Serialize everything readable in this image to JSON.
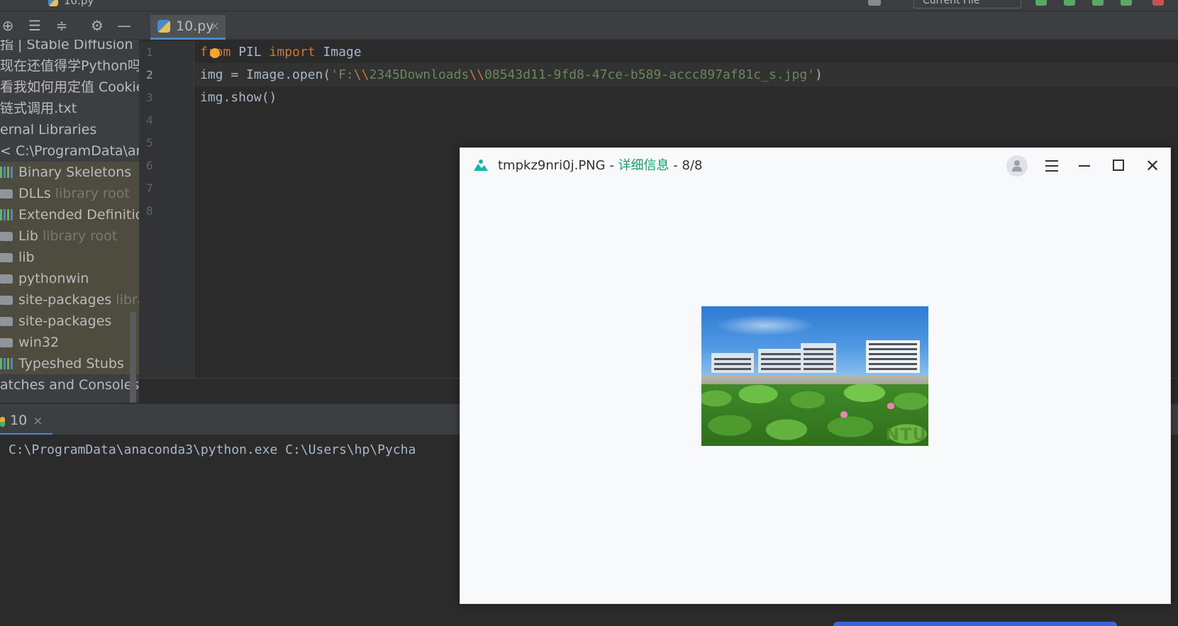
{
  "topbar": {
    "breadcrumb": "10.py",
    "run_config": "Current File",
    "colors": {
      "run": "#59a869",
      "debug": "#59a869",
      "stop": "#c75450"
    }
  },
  "project_toolbar": {
    "icons": [
      "crosshair-icon",
      "expand-all-icon",
      "collapse-all-icon",
      "gear-icon",
      "minimize-icon"
    ]
  },
  "project_tree": {
    "items": [
      {
        "label": "指 | Stable Diffusion",
        "hint": "",
        "icon": "",
        "lib": false
      },
      {
        "label": "现在还值得学Python吗?",
        "hint": "",
        "icon": "",
        "lib": false
      },
      {
        "label": "看我如何用定值 Cookie",
        "hint": "",
        "icon": "",
        "lib": false
      },
      {
        "label": "链式调用.txt",
        "hint": "",
        "icon": "",
        "lib": false
      },
      {
        "label": "ernal Libraries",
        "hint": "",
        "icon": "",
        "lib": false
      },
      {
        "label": "< C:\\ProgramData\\ana",
        "hint": "",
        "icon": "",
        "lib": false
      },
      {
        "label": "Binary Skeletons",
        "hint": "",
        "icon": "bars",
        "lib": true
      },
      {
        "label": "DLLs",
        "hint": "library root",
        "icon": "folder",
        "lib": true
      },
      {
        "label": "Extended Definition",
        "hint": "",
        "icon": "bars",
        "lib": true
      },
      {
        "label": "Lib",
        "hint": "library root",
        "icon": "folder",
        "lib": true
      },
      {
        "label": "lib",
        "hint": "",
        "icon": "folder",
        "lib": true
      },
      {
        "label": "pythonwin",
        "hint": "",
        "icon": "folder",
        "lib": true
      },
      {
        "label": "site-packages",
        "hint": "libra",
        "icon": "folder",
        "lib": true
      },
      {
        "label": "site-packages",
        "hint": "",
        "icon": "folder",
        "lib": true
      },
      {
        "label": "win32",
        "hint": "",
        "icon": "folder",
        "lib": true
      },
      {
        "label": "Typeshed Stubs",
        "hint": "",
        "icon": "bars",
        "lib": true
      },
      {
        "label": "atches and Consoles",
        "hint": "",
        "icon": "",
        "lib": false
      }
    ]
  },
  "editor": {
    "tab_label": "10.py",
    "tab_close": "×",
    "line_numbers": [
      "1",
      "2",
      "3",
      "4",
      "5",
      "6",
      "7",
      "8"
    ],
    "code": {
      "line1": {
        "kw1": "from",
        "t1": " PIL ",
        "kw2": "import",
        "t2": " Image"
      },
      "line2": {
        "t1": "img = Image.open(",
        "s1": "'F:",
        "e1": "\\\\",
        "s2": "2345Downloads",
        "e2": "\\\\",
        "s3": "08543d11-9fd8-47ce-b589-accc897af81c_s.jpg'",
        "t2": ")"
      },
      "line3": {
        "t1": "img.show()"
      }
    }
  },
  "run_panel": {
    "tab_label": "10",
    "tab_close": "×",
    "console_line": "C:\\ProgramData\\anaconda3\\python.exe C:\\Users\\hp\\Pycha"
  },
  "viewer": {
    "filename": "tmpkz9nri0j.PNG",
    "sep1": " - ",
    "detail_link": "详细信息",
    "sep2": " - ",
    "page": "8/8",
    "close_glyph": "✕",
    "photo_watermark": "NTU",
    "accent_color": "#0fa36b"
  }
}
